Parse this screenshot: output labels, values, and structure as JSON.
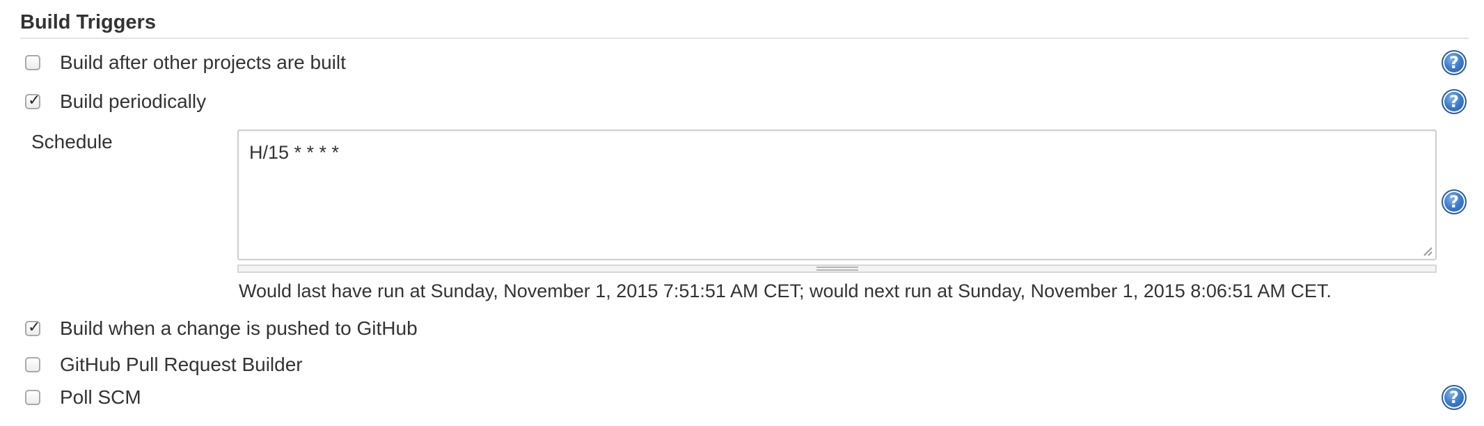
{
  "section": {
    "title": "Build Triggers"
  },
  "triggers": [
    {
      "label": "Build after other projects are built",
      "checked": false,
      "has_help": true
    },
    {
      "label": "Build periodically",
      "checked": true,
      "has_help": true
    },
    {
      "label": "Build when a change is pushed to GitHub",
      "checked": true,
      "has_help": false
    },
    {
      "label": "GitHub Pull Request Builder",
      "checked": false,
      "has_help": false
    },
    {
      "label": "Poll SCM",
      "checked": false,
      "has_help": true
    }
  ],
  "schedule": {
    "label": "Schedule",
    "value": "H/15 * * * *",
    "info": "Would last have run at Sunday, November 1, 2015 7:51:51 AM CET; would next run at Sunday, November 1, 2015 8:06:51 AM CET."
  },
  "icons": {
    "help": "help-question-icon",
    "checkmark": "checkmark-icon"
  },
  "colors": {
    "help_icon": "#3b7bd0",
    "text": "#333333",
    "rule": "#e4e4e4"
  }
}
